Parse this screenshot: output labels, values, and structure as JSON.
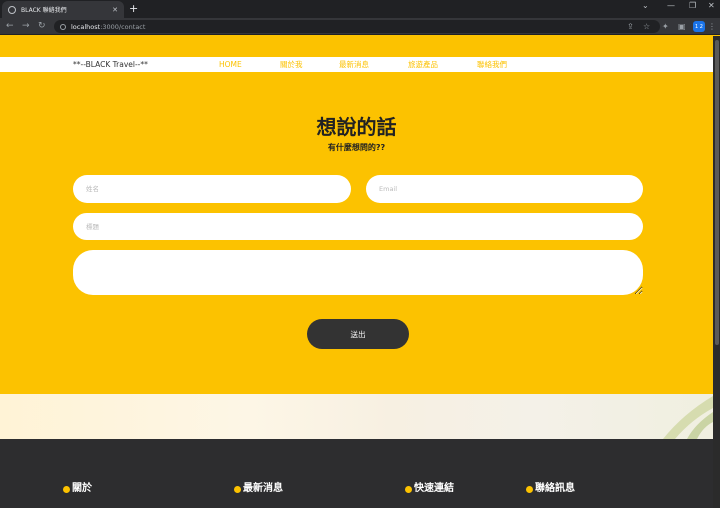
{
  "browser": {
    "tab_title": "BLACK 聯絡我們",
    "url_host": "localhost",
    "url_rest": ":3000/contact",
    "new_tab": "+",
    "profile_label": "1 2"
  },
  "site": {
    "brand": "**--BLACK Travel--**",
    "nav": [
      "HOME",
      "關於我",
      "最新消息",
      "旅遊產品",
      "聯絡我們"
    ]
  },
  "contact": {
    "title": "想說的話",
    "subtitle": "有什麼想問的??",
    "name_placeholder": "姓名",
    "email_placeholder": "Email",
    "subject_placeholder": "標題",
    "submit_label": "送出"
  },
  "footer": {
    "columns": [
      "關於",
      "最新消息",
      "快速連結",
      "聯絡訊息"
    ]
  },
  "colors": {
    "accent": "#fcc200",
    "dark": "#333333",
    "footer_bg": "#2d2d2f"
  }
}
